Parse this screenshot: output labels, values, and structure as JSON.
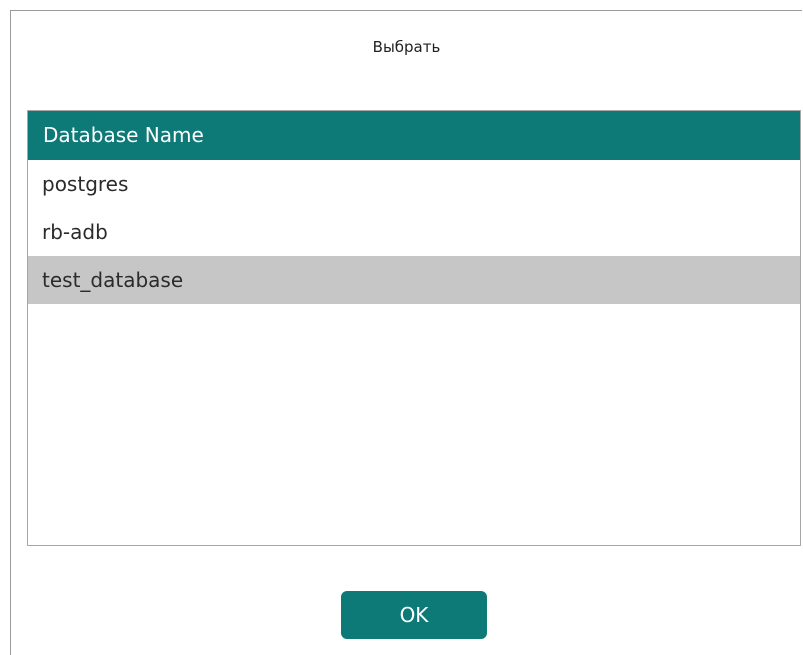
{
  "dialog": {
    "title": "Выбрать"
  },
  "table": {
    "header": "Database Name",
    "rows": [
      "postgres",
      "rb-adb",
      "test_database"
    ],
    "selected": "test_database"
  },
  "buttons": {
    "ok_label": "OK"
  },
  "colors": {
    "accent": "#0e7a78",
    "selected_row": "#c6c6c6"
  }
}
